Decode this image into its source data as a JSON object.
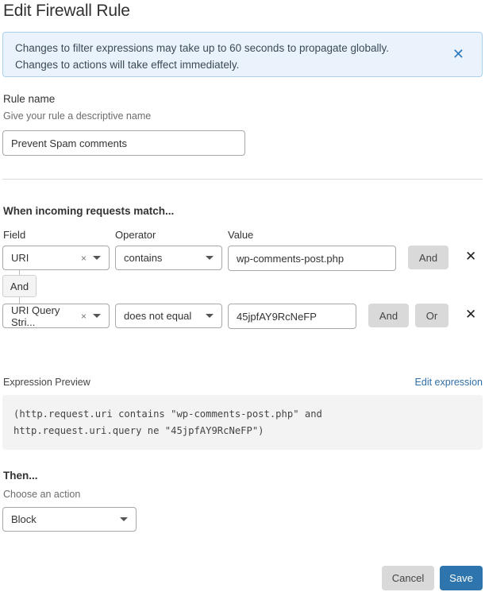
{
  "page": {
    "title": "Edit Firewall Rule"
  },
  "banner": {
    "line1": "Changes to filter expressions may take up to 60 seconds to propagate globally.",
    "line2": "Changes to actions will take effect immediately.",
    "close_icon": "close-icon"
  },
  "rule_name": {
    "label": "Rule name",
    "help": "Give your rule a descriptive name",
    "value": "Prevent Spam comments"
  },
  "match": {
    "heading": "When incoming requests match...",
    "columns": {
      "field": "Field",
      "operator": "Operator",
      "value": "Value"
    },
    "join_label": "And",
    "rows": [
      {
        "field": "URI",
        "operator": "contains",
        "value": "wp-comments-post.php",
        "buttons": [
          "And"
        ]
      },
      {
        "field": "URI Query Stri...",
        "operator": "does not equal",
        "value": "45jpfAY9RcNeFP",
        "buttons": [
          "And",
          "Or"
        ]
      }
    ]
  },
  "expression": {
    "label": "Expression Preview",
    "edit_link": "Edit expression",
    "line1": "(http.request.uri contains \"wp-comments-post.php\" and",
    "line2": "http.request.uri.query ne \"45jpfAY9RcNeFP\")"
  },
  "action": {
    "heading": "Then...",
    "help": "Choose an action",
    "selected": "Block"
  },
  "footer": {
    "cancel": "Cancel",
    "save": "Save"
  },
  "colors": {
    "primary": "#2e75ad",
    "banner_bg": "#eaf3fb",
    "banner_border": "#a9d0ea",
    "link": "#2f6fa8"
  }
}
